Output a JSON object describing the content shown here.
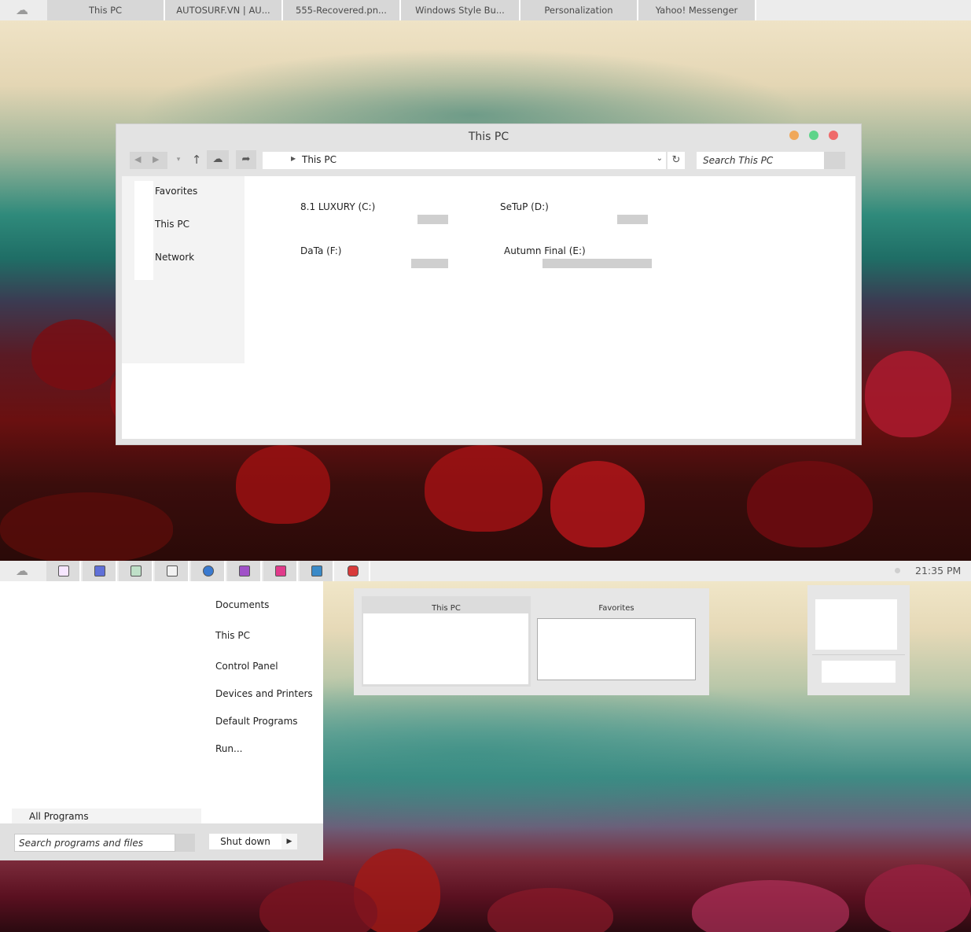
{
  "colors": {
    "taskbar_bg": "#ececec",
    "tab_bg": "#d7d7d7",
    "window_bg": "#e3e3e3",
    "dot_orange": "#f0a85a",
    "dot_green": "#5ed48a",
    "dot_red": "#ef6a6a"
  },
  "top_taskbar": {
    "icon": "cloud-icon",
    "tabs": [
      "This PC",
      "AUTOSURF.VN | AU...",
      "555-Recovered.pn...",
      "Windows Style Bu...",
      "Personalization",
      "Yahoo! Messenger"
    ]
  },
  "explorer": {
    "title": "This PC",
    "address": "This PC",
    "search_placeholder": "Search This PC",
    "nav": [
      "Favorites",
      "This PC",
      "Network"
    ],
    "drives": [
      {
        "label": "8.1 LUXURY (C:)"
      },
      {
        "label": "SeTuP (D:)"
      },
      {
        "label": "DaTa (F:)"
      },
      {
        "label": "Autumn Final (E:)"
      }
    ]
  },
  "bottom_taskbar": {
    "icon": "cloud-icon",
    "pinned_icons": [
      "window-app-icon",
      "compass-app-icon",
      "camera-app-icon",
      "panda-app-icon",
      "disc-app-icon",
      "photo-app-icon",
      "heart-app-icon",
      "puzzle-app-icon",
      "video-app-icon"
    ],
    "clock": "21:35 PM"
  },
  "start_menu": {
    "items": [
      "Documents",
      "This PC",
      "Control Panel",
      "Devices and Printers",
      "Default Programs",
      "Run..."
    ],
    "all_programs": "All Programs",
    "search_placeholder": "Search programs and files",
    "shutdown": "Shut down"
  },
  "previews": {
    "thumb1_title": "This PC",
    "thumb2_title": "Favorites"
  }
}
